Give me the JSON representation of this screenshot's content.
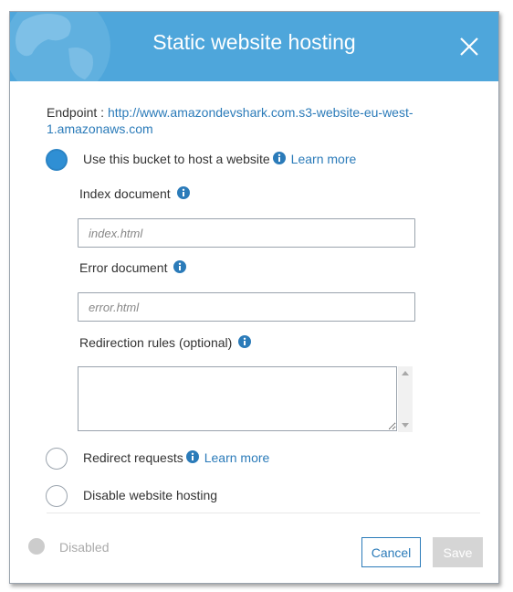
{
  "dialog": {
    "title": "Static website hosting",
    "close_icon": "close-icon"
  },
  "endpoint": {
    "label": "Endpoint :",
    "url": "http://www.amazondevshark.com.s3-website-eu-west-1.amazonaws.com"
  },
  "options": {
    "host": {
      "label": "Use this bucket to host a website",
      "learn_more": "Learn more",
      "selected": true
    },
    "redirect": {
      "label": "Redirect requests",
      "learn_more": "Learn more",
      "selected": false
    },
    "disable": {
      "label": "Disable website hosting",
      "selected": false
    }
  },
  "fields": {
    "index": {
      "label": "Index document",
      "placeholder": "index.html"
    },
    "error": {
      "label": "Error document",
      "placeholder": "error.html"
    },
    "redirection": {
      "label": "Redirection rules (optional)"
    }
  },
  "footer": {
    "toggle_label": "Disabled",
    "cancel_label": "Cancel",
    "save_label": "Save"
  },
  "colors": {
    "header": "#4ea6db",
    "link": "#2b7bb9",
    "radio_selected": "#2f8fd4",
    "disabled": "#d5d5d5"
  }
}
